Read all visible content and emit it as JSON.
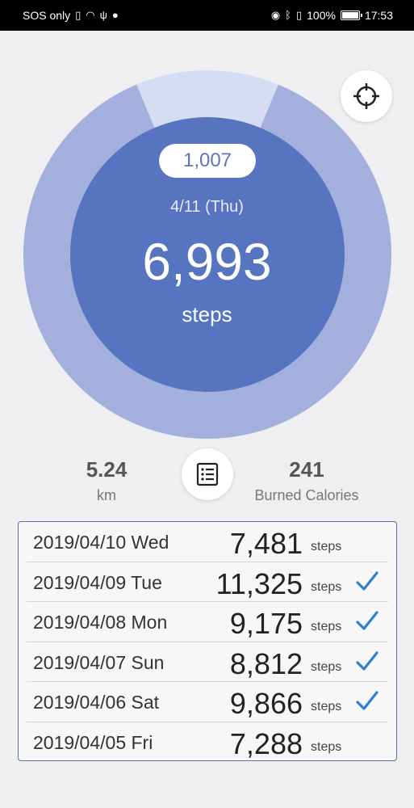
{
  "status_bar": {
    "carrier": "SOS only",
    "battery": "100%",
    "time": "17:53"
  },
  "main": {
    "goal": "1,007",
    "date": "4/11 (Thu)",
    "steps": "6,993",
    "steps_unit": "steps",
    "progress_fraction": 0.874
  },
  "stats": {
    "distance_value": "5.24",
    "distance_unit": "km",
    "calories_value": "241",
    "calories_unit": "Burned Calories"
  },
  "history": [
    {
      "date": "2019/04/10 Wed",
      "steps": "7,481",
      "unit": "steps",
      "achieved": false
    },
    {
      "date": "2019/04/09 Tue",
      "steps": "11,325",
      "unit": "steps",
      "achieved": true
    },
    {
      "date": "2019/04/08 Mon",
      "steps": "9,175",
      "unit": "steps",
      "achieved": true
    },
    {
      "date": "2019/04/07 Sun",
      "steps": "8,812",
      "unit": "steps",
      "achieved": true
    },
    {
      "date": "2019/04/06 Sat",
      "steps": "9,866",
      "unit": "steps",
      "achieved": true
    },
    {
      "date": "2019/04/05 Fri",
      "steps": "7,288",
      "unit": "steps",
      "achieved": false
    }
  ],
  "colors": {
    "ring_filled": "#a3b0dd",
    "ring_remaining": "#d6dcf1",
    "inner_circle": "#5674c0",
    "check": "#2f7fd4"
  },
  "icons": {
    "target": "crosshair-target-icon",
    "list": "list-icon",
    "check": "checkmark-icon"
  }
}
